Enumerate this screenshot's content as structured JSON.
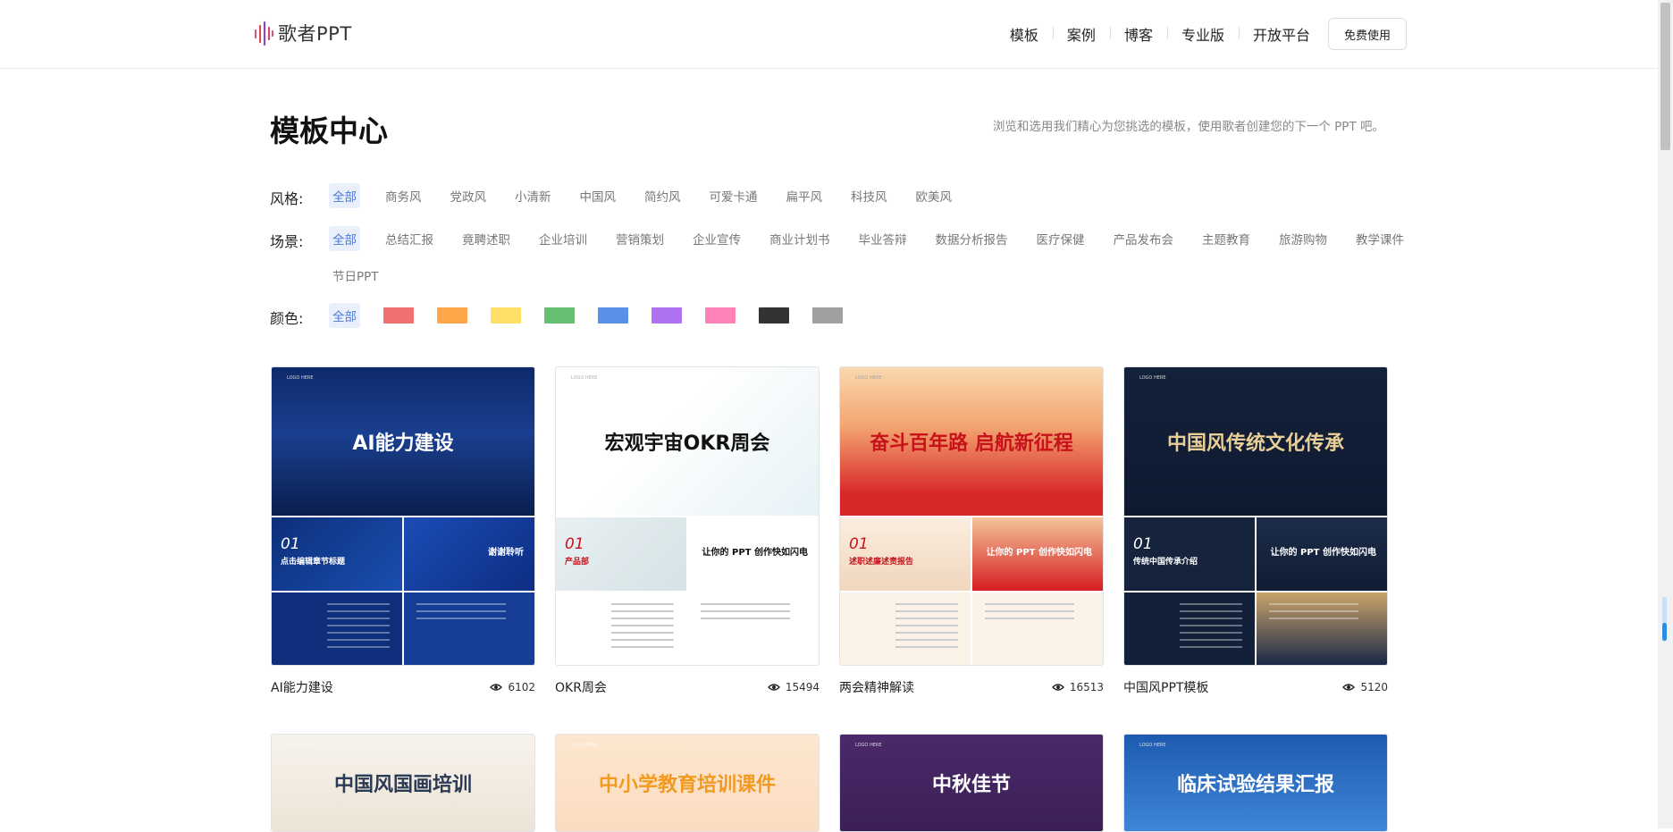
{
  "header": {
    "logo_text": "歌者PPT",
    "nav": [
      "模板",
      "案例",
      "博客",
      "专业版",
      "开放平台"
    ],
    "free_btn": "免费使用"
  },
  "title": "模板中心",
  "subtitle": "浏览和选用我们精心为您挑选的模板，使用歌者创建您的下一个 PPT 吧。",
  "filters": {
    "style": {
      "label": "风格:",
      "options": [
        "全部",
        "商务风",
        "党政风",
        "小清新",
        "中国风",
        "简约风",
        "可爱卡通",
        "扁平风",
        "科技风",
        "欧美风"
      ]
    },
    "scene": {
      "label": "场景:",
      "options": [
        "全部",
        "总结汇报",
        "竟聘述职",
        "企业培训",
        "营销策划",
        "企业宣传",
        "商业计划书",
        "毕业答辩",
        "数据分析报告",
        "医疗保健",
        "产品发布会",
        "主题教育",
        "旅游购物",
        "教学课件",
        "节日PPT"
      ]
    },
    "color": {
      "label": "颜色:",
      "all": "全部",
      "swatches": [
        "#f07070",
        "#ffa64a",
        "#ffdf66",
        "#66bf70",
        "#5b90e8",
        "#ae72f0",
        "#ff82b8",
        "#333333",
        "#a0a0a0"
      ]
    }
  },
  "cards": [
    {
      "name": "AI能力建设",
      "views": "6102",
      "cover_title": "AI能力建设",
      "slide_num": "01",
      "slide_sub": "点击编辑章节标题",
      "slide_text": "谢谢聆听",
      "theme": "blue"
    },
    {
      "name": "OKR周会",
      "views": "15494",
      "cover_title": "宏观宇宙OKR周会",
      "slide_num": "01",
      "slide_sub": "产品部",
      "slide_text": "让你的 PPT 创作快如闪电",
      "theme": "light"
    },
    {
      "name": "两会精神解读",
      "views": "16513",
      "cover_title": "奋斗百年路 启航新征程",
      "slide_num": "01",
      "slide_sub": "述职述廉述责报告",
      "slide_text": "让你的 PPT 创作快如闪电",
      "theme": "red"
    },
    {
      "name": "中国风PPT模板",
      "views": "5120",
      "cover_title": "中国风传统文化传承",
      "slide_num": "01",
      "slide_sub": "传统中国传承介绍",
      "slide_text": "让你的 PPT 创作快如闪电",
      "theme": "navy"
    },
    {
      "name": "",
      "views": "",
      "cover_title": "中国风国画培训",
      "theme": "ink"
    },
    {
      "name": "",
      "views": "",
      "cover_title": "中小学教育培训课件",
      "theme": "peach"
    },
    {
      "name": "",
      "views": "",
      "cover_title": "中秋佳节",
      "theme": "purple"
    },
    {
      "name": "",
      "views": "",
      "cover_title": "临床试验结果汇报",
      "theme": "sky"
    }
  ]
}
